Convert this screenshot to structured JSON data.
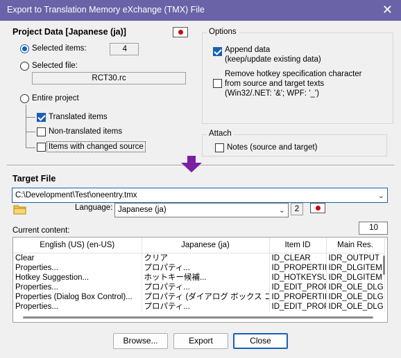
{
  "window": {
    "title": "Export to Translation Memory eXchange (TMX) File",
    "close_glyph": "✕"
  },
  "project": {
    "title": "Project Data [Japanese (ja)]",
    "selected_items_label": "Selected items:",
    "selected_items_count": "4",
    "selected_file_label": "Selected file:",
    "selected_file_value": "RCT30.rc",
    "entire_project_label": "Entire project",
    "translated_label": "Translated items",
    "non_translated_label": "Non-translated items",
    "changed_source_label": "Items with changed source"
  },
  "options": {
    "title": "Options",
    "append_line1": "Append data",
    "append_line2": "(keep/update existing data)",
    "hotkey_line1": "Remove hotkey specification character",
    "hotkey_line2": "from source and target texts",
    "hotkey_line3": "(Win32/.NET: '&'; WPF: '_')"
  },
  "attach": {
    "title": "Attach",
    "notes_label": "Notes (source and target)"
  },
  "target": {
    "title": "Target File",
    "path": "C:\\Development\\Test\\oneentry.tmx",
    "language_label": "Language:",
    "language_value": "Japanese (ja)",
    "language_count": "2",
    "current_content_label": "Current content:",
    "content_count": "10"
  },
  "table": {
    "columns": [
      "English (US) (en-US)",
      "Japanese (ja)",
      "Item ID",
      "Main Res."
    ],
    "rows": [
      [
        "Clear",
        "クリア",
        "ID_CLEAR",
        "IDR_OUTPUT"
      ],
      [
        "Properties...",
        "プロパティ...",
        "ID_PROPERTIES",
        "IDR_DLGITEM"
      ],
      [
        "Hotkey Suggestion...",
        "ホットキー候補...",
        "ID_HOTKEYSUGG",
        "IDR_DLGITEM"
      ],
      [
        "Properties...",
        "プロパティ...",
        "ID_EDIT_PROPERTIES",
        "IDR_OLE_DLG"
      ],
      [
        "Properties (Dialog Box Control)...",
        "プロパティ (ダイアログ ボックス コントロール)...",
        "ID_PROPERTIES",
        "IDR_OLE_DLG"
      ],
      [
        "Properties...",
        "プロパティ...",
        "ID_EDIT_PROPERTIES",
        "IDR_OLE_DLG"
      ]
    ]
  },
  "buttons": {
    "browse": "Browse...",
    "export": "Export",
    "close": "Close"
  },
  "colors": {
    "titlebar": "#6a63a8",
    "accent": "#1a5fb4",
    "arrow": "#7b1fa2",
    "flag_red": "#d00000"
  }
}
